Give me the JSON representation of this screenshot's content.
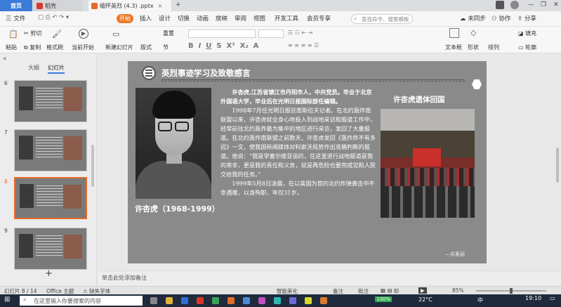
{
  "tabs": {
    "home": "首页",
    "t2": "稻壳",
    "t3": "缅怀英烈 (4.3) .pptx"
  },
  "menu": {
    "file": "三 文件",
    "start": "开始",
    "items": [
      "插入",
      "设计",
      "切换",
      "动画",
      "放映",
      "审阅",
      "视图",
      "开发工具",
      "会员专享"
    ],
    "search_placeholder": "查找命令、搜索模板",
    "unsync": "未同步",
    "collab": "协作",
    "share": "分享"
  },
  "ribbon": {
    "paste": "粘贴",
    "cut": "剪切",
    "copy": "复制",
    "format_painter": "格式刷",
    "play_from_current": "当前开始",
    "new_slide": "新建幻灯片",
    "layout": "版式",
    "section": "节",
    "reset": "重置",
    "textbox": "文本框",
    "shape": "形状",
    "arrange": "排列",
    "fill": "填充",
    "outline": "轮廓"
  },
  "panel": {
    "tab_outline": "大纲",
    "tab_slides": "幻灯片",
    "slides": [
      {
        "num": "6"
      },
      {
        "num": "7"
      },
      {
        "num": "8"
      },
      {
        "num": "9"
      }
    ]
  },
  "slide": {
    "title": "英烈事迹学习及致敬感言",
    "caption": "许杏虎（1968-1999）",
    "right_title": "许杏虎遗体回国",
    "para1": "许杏虎,江苏省镇江市丹阳市人，中共党员。毕业于北京外国语大学，毕业后在光明日报国际部任编辑。",
    "para2": "1998年7月任光明日报驻南斯拉夫记者。在北约轰炸南联盟以来，许杏虎就全身心地投入到战地采访和报道工作中，经常前往北约轰炸最为集中的地区进行采访，发回了大量报道。在北约轰炸南联盟之前数天，许杏虎发回《轰炸炸不有多远》一文，使我国新闻媒体对科索沃局势作出准确判断的报道。他说：“我是学塞尔维亚语的，在这里进行战地报道是我的荣幸，更是我的责任和义务，就是再危险也要完成党和人民交给我的任务。”",
    "para3": "1999年5月8日凌晨，在以美国为首的北约炸弹袭击中不幸遇难，以身殉职，年仅31岁。",
    "signature": "—苏素丽"
  },
  "notes": {
    "placeholder": "单击此处添加备注"
  },
  "status": {
    "slide_counter": "幻灯片 8 / 14",
    "theme": "Office 主题",
    "missing_font": "缺失字体",
    "smart_beautify": "智能美化",
    "notes": "备注",
    "comment": "批注",
    "zoom": "85%"
  },
  "taskbar": {
    "search_placeholder": "在这里输入你要搜索的内容",
    "battery": "100%",
    "temp": "22°C",
    "lang": "中",
    "time": "19:10"
  }
}
